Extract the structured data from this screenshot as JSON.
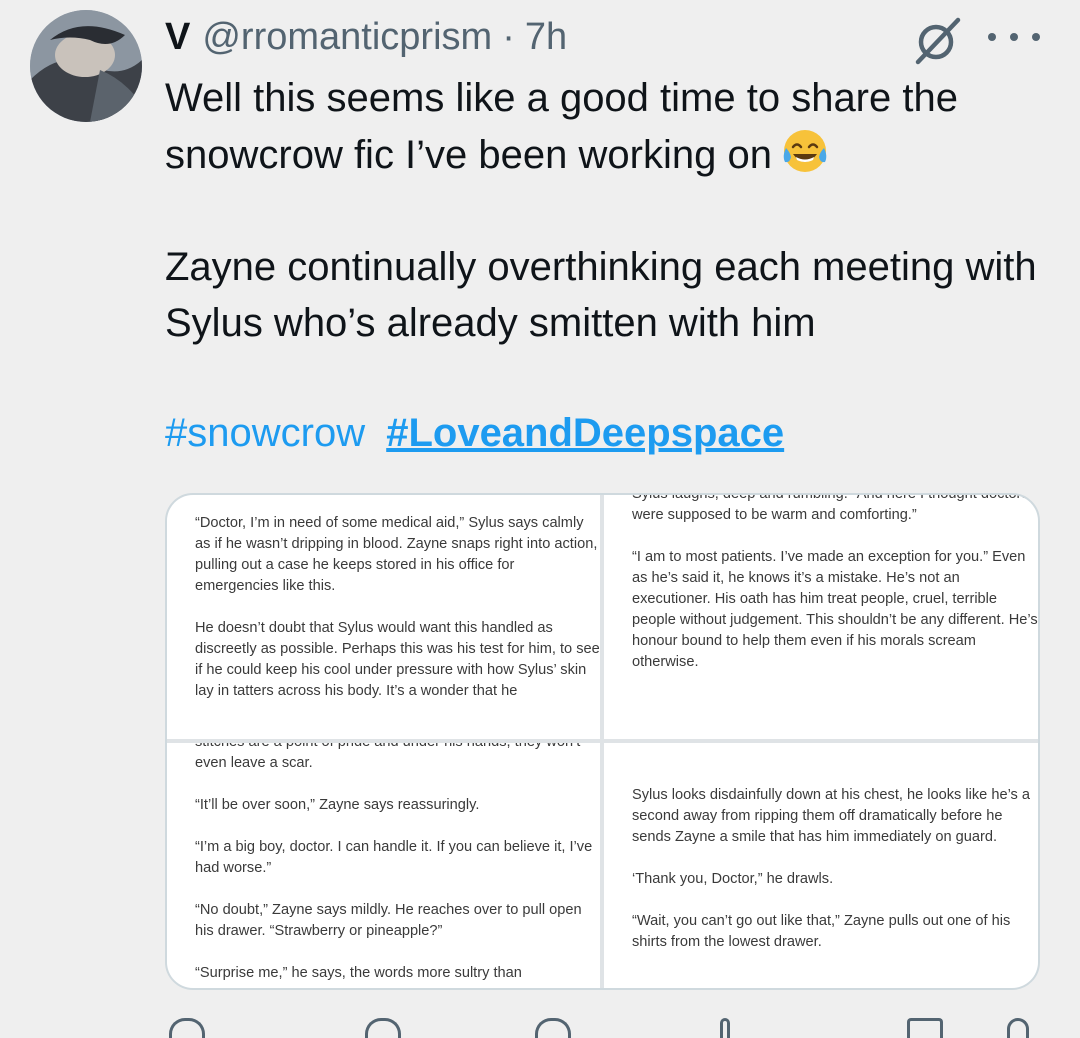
{
  "tweet": {
    "display_name": "V",
    "handle": "@rromanticprism",
    "separator": "·",
    "time": "7h",
    "text_line1": "Well this seems like a good time to share the snowcrow fic I’ve been working on",
    "text_line2": "Zayne continually overthinking each meeting with Sylus who’s already smitten with him",
    "hashtag1": "#snowcrow",
    "hashtag2": "#LoveandDeepspace",
    "emoji": "face-with-tears-of-joy",
    "icons": [
      "grok-icon",
      "more-options-icon"
    ]
  },
  "media": {
    "top_left": [
      "“Doctor, I’m in need of some medical aid,” Sylus says calmly as if he wasn’t dripping in blood. Zayne snaps right into action, pulling out a case he keeps stored in his office for emergencies like this.",
      "",
      "He doesn’t doubt that Sylus would want this handled as discreetly as possible. Perhaps this was his test for him, to see if he could keep his cool under pressure with how Sylus’ skin lay in tatters across his body. It’s a wonder that he"
    ],
    "top_right": [
      "Sylus laughs, deep and rumbling. “And here I thought doctors were supposed to be warm and comforting.”",
      "",
      "“I am to most patients. I’ve made an exception for you.” Even as he’s said it, he knows it’s a mistake. He’s not an executioner. His oath has him treat people, cruel, terrible people without judgement. This shouldn’t be any different. He’s honour bound to help them even if his morals scream otherwise."
    ],
    "bottom_left": [
      "stitches are a point of pride and under his hands, they won’t even leave a scar.",
      "",
      "“It’ll be over soon,” Zayne says reassuringly.",
      "",
      "“I’m a big boy, doctor. I can handle it. If you can believe it, I’ve had worse.”",
      "",
      "“No doubt,” Zayne says mildly. He reaches over to pull open his drawer. “Strawberry or pineapple?”",
      "",
      "“Surprise me,” he says, the words more sultry than"
    ],
    "bottom_right": [
      "",
      "",
      "Sylus looks disdainfully down at his chest, he looks like he’s a second away from ripping them off dramatically before he sends Zayne a smile that has him immediately on guard.",
      "",
      "‘Thank you, Doctor,” he drawls.",
      "",
      "“Wait, you can’t go out like that,” Zayne pulls out one of his shirts from the lowest drawer."
    ]
  },
  "actions": [
    "reply-icon",
    "repost-icon",
    "like-icon",
    "views-icon",
    "bookmark-icon",
    "share-icon"
  ],
  "colors": {
    "background": "#efefef",
    "link": "#1d9bf0",
    "secondary_text": "#536471"
  }
}
